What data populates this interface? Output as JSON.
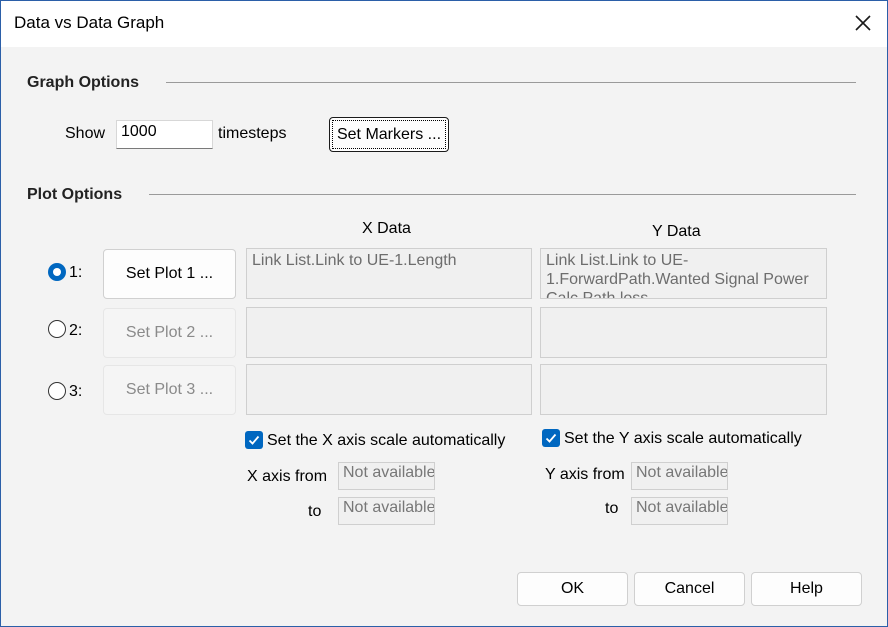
{
  "window": {
    "title": "Data vs Data Graph",
    "close_icon": "close-icon"
  },
  "graph_options": {
    "heading": "Graph Options",
    "show_label": "Show",
    "timesteps_value": "1000",
    "timesteps_label": "timesteps",
    "set_markers_label": "Set Markers ..."
  },
  "plot_options": {
    "heading": "Plot Options",
    "x_header": "X Data",
    "y_header": "Y Data",
    "plots": [
      {
        "radio_label": "1:",
        "button_label": "Set Plot 1 ...",
        "selected": true,
        "enabled": true,
        "x_data": "Link List.Link to UE-1.Length",
        "y_data": "Link List.Link to UE-1.ForwardPath.Wanted Signal Power Calc.Path loss"
      },
      {
        "radio_label": "2:",
        "button_label": "Set Plot 2 ...",
        "selected": false,
        "enabled": false,
        "x_data": "",
        "y_data": ""
      },
      {
        "radio_label": "3:",
        "button_label": "Set Plot 3 ...",
        "selected": false,
        "enabled": false,
        "x_data": "",
        "y_data": ""
      }
    ]
  },
  "axis": {
    "x_auto_label": "Set the X axis scale automatically",
    "y_auto_label": "Set the Y axis scale automatically",
    "x_auto_checked": true,
    "y_auto_checked": true,
    "x_from_label": "X axis from",
    "y_from_label": "Y axis from",
    "to_label": "to",
    "x_from_value": "Not available",
    "x_to_value": "Not available",
    "y_from_value": "Not available",
    "y_to_value": "Not available"
  },
  "buttons": {
    "ok": "OK",
    "cancel": "Cancel",
    "help": "Help"
  },
  "colors": {
    "accent": "#0067c0",
    "border": "#2b5fa8",
    "background": "#f3f3f3"
  }
}
